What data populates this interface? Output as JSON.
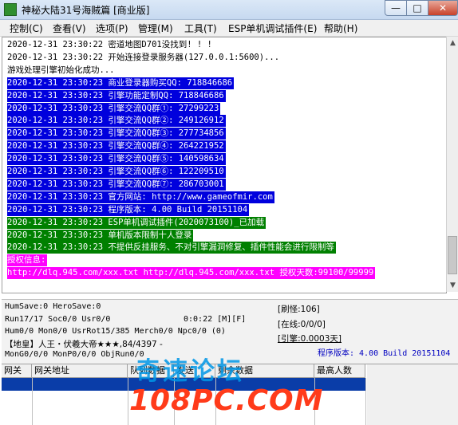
{
  "window": {
    "title": "神秘大陆31号海贼篇 [商业版]",
    "minimize": "—",
    "maximize": "□",
    "close": "✕"
  },
  "menu": [
    "控制(C)",
    "查看(V)",
    "选项(P)",
    "管理(M)",
    "工具(T)",
    "ESP单机调试插件(E)",
    "帮助(H)"
  ],
  "log": [
    {
      "text": "2020-12-31 23:30:22 密道地图D701没找到! ! !",
      "hl": "none"
    },
    {
      "text": "2020-12-31 23:30:22 开始连接登录服务器(127.0.0.1:5600)...",
      "hl": "none"
    },
    {
      "text": "游戏处理引擎初始化成功...",
      "hl": "none"
    },
    {
      "text": "2020-12-31 23:30:23 商业登录器购买QQ: 718846686",
      "hl": "blue"
    },
    {
      "text": "2020-12-31 23:30:23 引擎功能定制QQ: 718846686",
      "hl": "blue"
    },
    {
      "text": "2020-12-31 23:30:23 引擎交流QQ群①: 27299223",
      "hl": "blue"
    },
    {
      "text": "2020-12-31 23:30:23 引擎交流QQ群②: 249126912",
      "hl": "blue"
    },
    {
      "text": "2020-12-31 23:30:23 引擎交流QQ群③: 277734856",
      "hl": "blue"
    },
    {
      "text": "2020-12-31 23:30:23 引擎交流QQ群④: 264221952",
      "hl": "blue"
    },
    {
      "text": "2020-12-31 23:30:23 引擎交流QQ群⑤: 140598634",
      "hl": "blue"
    },
    {
      "text": "2020-12-31 23:30:23 引擎交流QQ群⑥: 122209510",
      "hl": "blue"
    },
    {
      "text": "2020-12-31 23:30:23 引擎交流QQ群⑦: 286703001",
      "hl": "blue"
    },
    {
      "text": "2020-12-31 23:30:23 官方网站: http://www.gameofmir.com",
      "hl": "blue"
    },
    {
      "text": "2020-12-31 23:30:23 程序版本: 4.00 Build 20151104",
      "hl": "blue"
    },
    {
      "text": "2020-12-31 23:30:23 ESP单机调试插件(2020073100)_已加载",
      "hl": "green"
    },
    {
      "text": "2020-12-31 23:30:23 单机版本限制十人登录",
      "hl": "green"
    },
    {
      "text": "2020-12-31 23:30:23 不提供反挂服务、不对引擎漏洞修复、插件性能会进行限制等",
      "hl": "green"
    },
    {
      "text": "授权信息:",
      "hl": "magenta"
    },
    {
      "text": "http://dlq.945.com/xxx.txt http://dlq.945.com/xxx.txt 授权天数:99100/99999",
      "hl": "magenta"
    }
  ],
  "status": {
    "line1": "HumSave:0 HeroSave:0",
    "line2a": "Run17/17 Soc0/0 Usr0/0",
    "line2b": "0:0:22 [M][F]",
    "line3": "Hum0/0 Mon0/0 UsrRot15/385 Merch0/0 Npc0/0 (0)",
    "line4": "【地皇】人王・伏羲大帝★★★,84/4397 -",
    "line5": "MonG0/0/0 MonP0/0/0 ObjRun0/0",
    "box1": "[刷怪:106]",
    "box2": "[在线:0/0/0]",
    "box3": "[引擎:0.0003天]",
    "version": "程序版本: 4.00 Build 20151104"
  },
  "grid": {
    "columns": [
      "网关",
      "网关地址",
      "队列数据",
      "发送",
      "剩余数据",
      "最高人数"
    ]
  },
  "watermark": {
    "top": "奇速论坛",
    "bottom": "108PC.COM"
  }
}
